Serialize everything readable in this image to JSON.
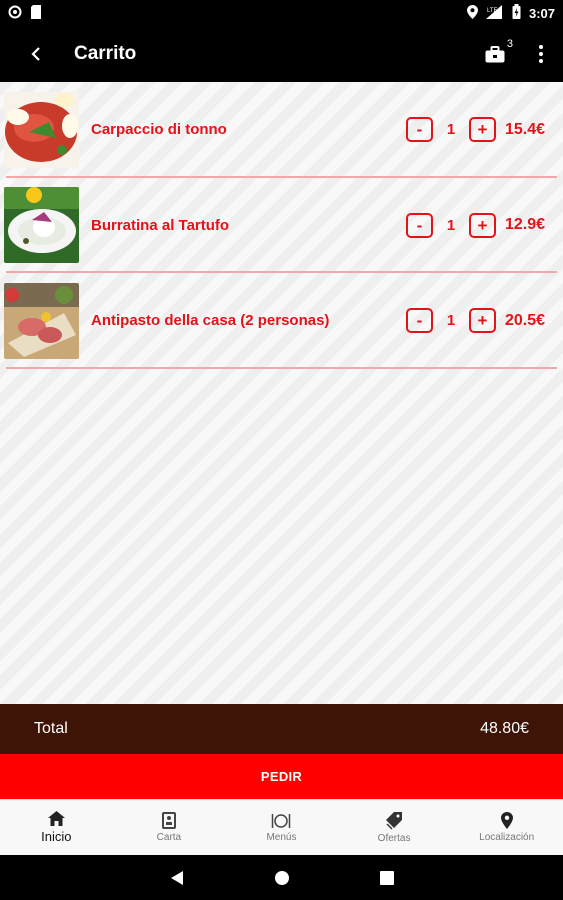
{
  "status_bar": {
    "time": "3:07",
    "network": "LTE"
  },
  "app_bar": {
    "title": "Carrito",
    "cart_count": "3"
  },
  "cart": {
    "items": [
      {
        "name": "Carpaccio di tonno",
        "quantity": "1",
        "price": "15.4€",
        "minus": "-",
        "plus": "+"
      },
      {
        "name": "Burratina al Tartufo",
        "quantity": "1",
        "price": "12.9€",
        "minus": "-",
        "plus": "+"
      },
      {
        "name": "Antipasto della casa (2 personas)",
        "quantity": "1",
        "price": "20.5€",
        "minus": "-",
        "plus": "+"
      }
    ],
    "total_label": "Total",
    "total_value": "48.80€",
    "order_button": "PEDIR"
  },
  "bottom_nav": {
    "items": [
      {
        "label": "Inicio",
        "icon": "home-icon",
        "active": true
      },
      {
        "label": "Carta",
        "icon": "menu-card-icon",
        "active": false
      },
      {
        "label": "Menús",
        "icon": "dish-icon",
        "active": false
      },
      {
        "label": "Ofertas",
        "icon": "tag-icon",
        "active": false
      },
      {
        "label": "Localización",
        "icon": "location-pin-icon",
        "active": false
      }
    ]
  },
  "colors": {
    "accent": "#e2141a",
    "order_button": "#fe0000",
    "total_bar": "#3d1405"
  }
}
